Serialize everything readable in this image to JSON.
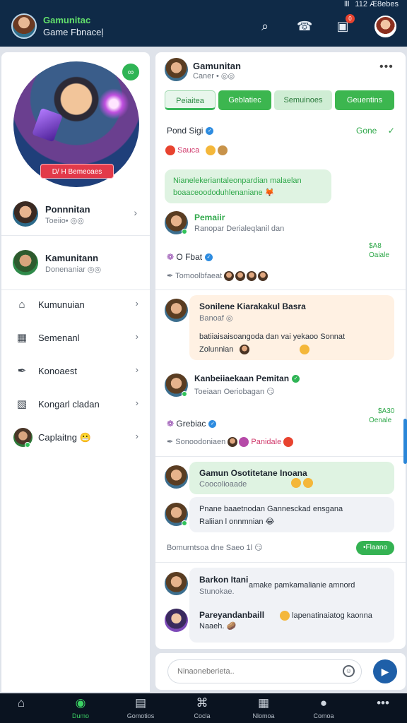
{
  "status": {
    "signal": "ӏӏӏ",
    "text": "112 Æ8ebes"
  },
  "header": {
    "title": "Gamunitac",
    "subtitle": "Game Fbnaceļ",
    "notification_count": "0"
  },
  "left_panel": {
    "hero_label": "D/ H Bemeoaes",
    "profile": {
      "name": "Ponnnitan",
      "subtitle": "Toeiio• ◎◎"
    },
    "community": {
      "name": "Kamunitann",
      "subtitle": "Donenaniar ◎◎"
    },
    "menu": [
      {
        "label": "Kumunuian",
        "icon": "home-icon"
      },
      {
        "label": "Semenanl",
        "icon": "calendar-icon"
      },
      {
        "label": "Konoaest",
        "icon": "pin-icon"
      },
      {
        "label": "Kongarl cladan",
        "icon": "image-icon"
      },
      {
        "label": "Caplaitng 😬",
        "icon": "avatar"
      }
    ]
  },
  "chat": {
    "title": "Gamunitan",
    "subtitle": "Caner • ◎◎",
    "tabs": [
      "Peiaitea",
      "Geblatiec",
      "Semuinoes",
      "Geuentins"
    ],
    "rows": {
      "pond_sign": "Pond Sigi",
      "gone": "Gone",
      "sauca": "Sauca",
      "bubble1_line1": "Nianelekeriantaleonpardian malaelan",
      "bubble1_line2": "boaaceoododuhlenaniane 🦊",
      "msg1_name": "Pemaiir",
      "msg1_sub": "Ranopar Derialeqlanil dan",
      "time1_a": "$A8",
      "time1_b": "Oaiale",
      "o_bat": "O Fbat",
      "tomonyb": "Tomoolbfaeat",
      "orange_title": "Sonilene Kiarakakul Basra",
      "orange_sub": "Banoaf ◎",
      "orange_body1": "batiiaisaisoangoda dan vai yekaoo Sonnat",
      "orange_body2": "Zolunnian",
      "msg2_name": "Kanbeiiaekaan Pemitan",
      "msg2_sub": "Toeiaan Oeriobagan 😏",
      "time2_a": "$A30",
      "time2_b": "Oenale",
      "grebiac": "Grebiac",
      "sonoolo": "Sonoodoniaen",
      "pandale": "Panidale",
      "green_title": "Gamun Osotitetane Inoana",
      "green_sub": "Coocolioaade",
      "grey1_line1": "Pnane baaetnodan Gannesckad ensgana",
      "grey1_line2": "Raliian l onnmnian 😂",
      "inline_msg": "Bomurntsoa dne Saeo 1l 😏",
      "pill": "•Flaano",
      "grey2_title": "Barkon Itani",
      "grey2_body1": "amake pamkamalianie amnord",
      "grey2_sub": "Stunokae.",
      "grey2_name2": "Pareyandanbaill",
      "grey2_body2": "lapenatinaiatog kaonna",
      "grey2_sub2": "Naaeh. 🥔"
    }
  },
  "input": {
    "placeholder": "Ninaoneberieta.."
  },
  "nav": [
    {
      "label": "",
      "icon": "home-icon"
    },
    {
      "label": "Dumo",
      "icon": "game-icon"
    },
    {
      "label": "Gomotios",
      "icon": "store-icon"
    },
    {
      "label": "Cocla",
      "icon": "controller-icon"
    },
    {
      "label": "Nlomoa",
      "icon": "grid-icon"
    },
    {
      "label": "Comoa",
      "icon": "person-icon"
    },
    {
      "label": "",
      "icon": "more-icon"
    }
  ]
}
